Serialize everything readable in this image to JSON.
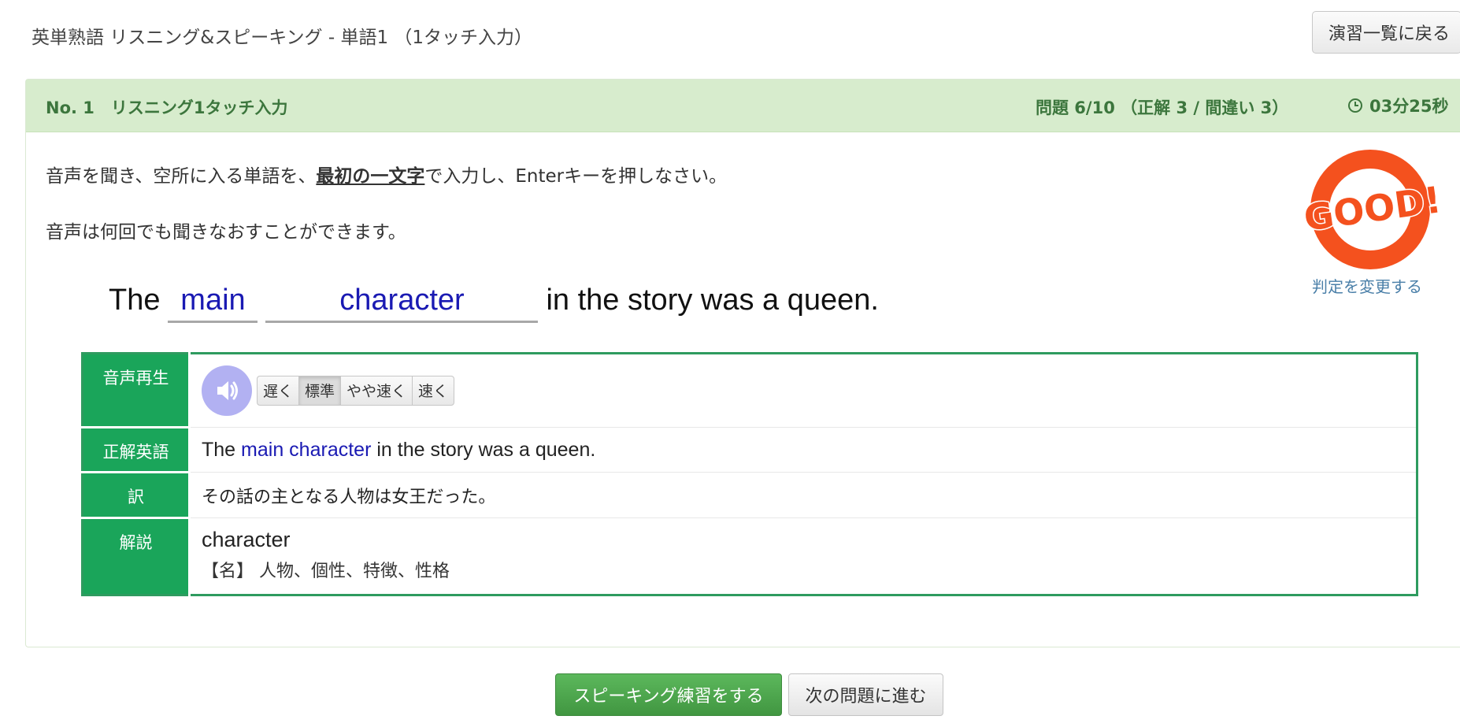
{
  "page": {
    "title": "英単熟語 リスニング&スピーキング - 単語1 （1タッチ入力）",
    "back_button": "演習一覧に戻る"
  },
  "panel": {
    "header_title": "No. 1　リスニング1タッチ入力",
    "progress": "問題 6/10 （正解 3 / 間違い 3）",
    "timer": "03分25秒"
  },
  "instructions": {
    "line1_before": "音声を聞き、空所に入る単語を、",
    "line1_emphasis": "最初の一文字",
    "line1_after": "で入力し、Enterキーを押しなさい。",
    "line2": "音声は何回でも聞きなおすことができます。"
  },
  "sentence": {
    "prefix": "The",
    "blank1": "main",
    "blank2": "character",
    "suffix": "in the story was a queen."
  },
  "judgment": {
    "stamp_text": "GOOD!",
    "change_link": "判定を変更する"
  },
  "info_table": {
    "audio_label": "音声再生",
    "speeds": [
      "遅く",
      "標準",
      "やや速く",
      "速く"
    ],
    "active_speed": "標準",
    "answer_label": "正解英語",
    "answer": {
      "before": "The",
      "highlight": "main character",
      "after": "in the story was a queen."
    },
    "translation_label": "訳",
    "translation": "その話の主となる人物は女王だった。",
    "explanation_label": "解説",
    "explanation_word": "character",
    "explanation_meaning": "【名】 人物、個性、特徴、性格"
  },
  "footer": {
    "speaking_button": "スピーキング練習をする",
    "next_button": "次の問題に進む"
  },
  "colors": {
    "header_bg": "#d7eccd",
    "header_text": "#3c763d",
    "table_label_bg": "#1aa55a",
    "answer_highlight": "#1a1ab3",
    "stamp": "#f4511e",
    "speaker_button": "#b2b1f2",
    "speaking_button": "#5cb85c"
  }
}
